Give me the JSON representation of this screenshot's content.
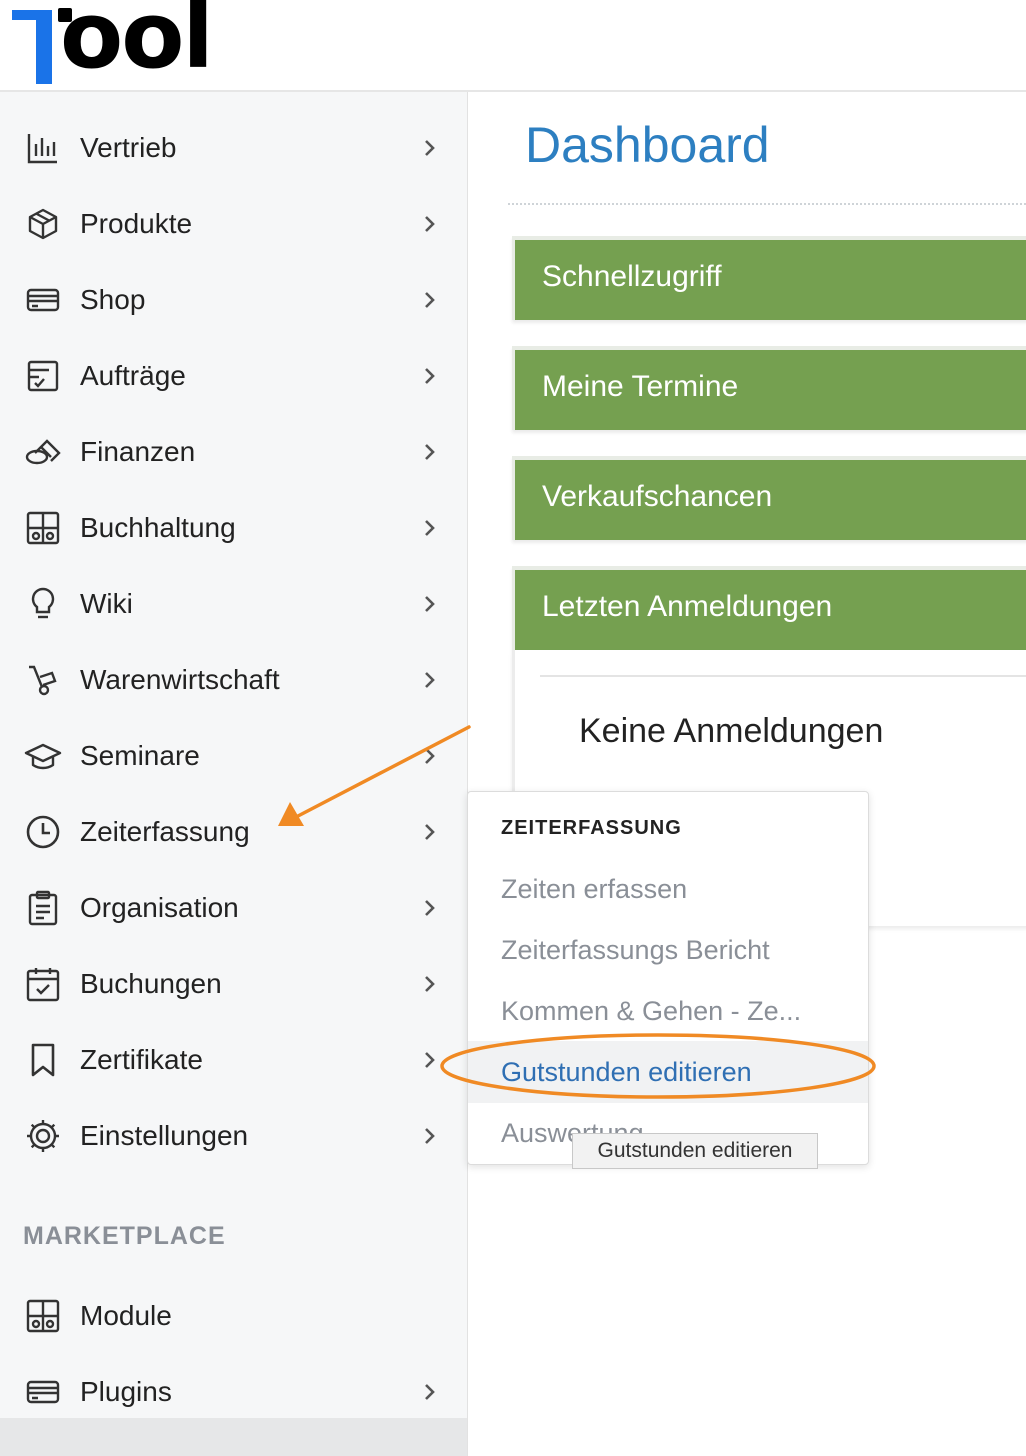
{
  "app": {
    "logo_text": "ool"
  },
  "sidebar": {
    "items": [
      {
        "label": "Vertrieb",
        "icon": "bar-chart-icon"
      },
      {
        "label": "Produkte",
        "icon": "box-icon"
      },
      {
        "label": "Shop",
        "icon": "credit-card-icon"
      },
      {
        "label": "Aufträge",
        "icon": "clipboard-check-icon"
      },
      {
        "label": "Finanzen",
        "icon": "coins-icon"
      },
      {
        "label": "Buchhaltung",
        "icon": "calculator-icon"
      },
      {
        "label": "Wiki",
        "icon": "lightbulb-icon"
      },
      {
        "label": "Warenwirtschaft",
        "icon": "hand-truck-icon"
      },
      {
        "label": "Seminare",
        "icon": "graduation-cap-icon"
      },
      {
        "label": "Zeiterfassung",
        "icon": "clock-icon"
      },
      {
        "label": "Organisation",
        "icon": "clipboard-list-icon"
      },
      {
        "label": "Buchungen",
        "icon": "calendar-check-icon"
      },
      {
        "label": "Zertifikate",
        "icon": "bookmark-icon"
      },
      {
        "label": "Einstellungen",
        "icon": "gear-icon"
      }
    ],
    "marketplace_title": "MARKETPLACE",
    "marketplace_items": [
      {
        "label": "Module",
        "icon": "calculator-icon"
      },
      {
        "label": "Plugins",
        "icon": "credit-card-icon"
      }
    ]
  },
  "main": {
    "title": "Dashboard",
    "panels": [
      {
        "title": "Schnellzugriff"
      },
      {
        "title": "Meine Termine"
      },
      {
        "title": "Verkaufschancen"
      },
      {
        "title": "Letzten Anmeldungen"
      }
    ],
    "last_logins_empty": "Keine Anmeldungen"
  },
  "flyout": {
    "title": "ZEITERFASSUNG",
    "items": [
      {
        "label": "Zeiten erfassen"
      },
      {
        "label": "Zeiterfassungs Bericht"
      },
      {
        "label": "Kommen & Gehen - Ze..."
      },
      {
        "label": "Gutstunden editieren"
      },
      {
        "label": "Auswertung"
      }
    ]
  },
  "tooltip": {
    "text": "Gutstunden editieren"
  },
  "annotation": {
    "color": "#f08a24"
  }
}
